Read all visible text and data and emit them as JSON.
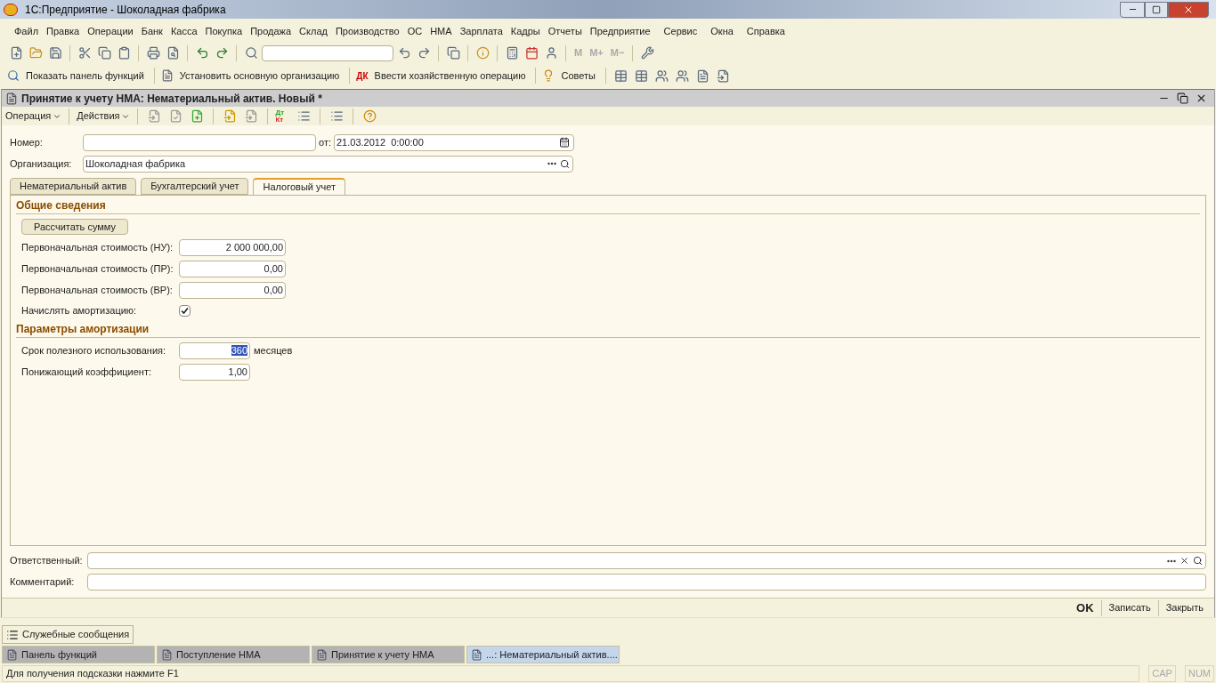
{
  "window": {
    "title": "1С:Предприятие - Шоколадная фабрика"
  },
  "menu": [
    "Файл",
    "Правка",
    "Операции",
    "Банк",
    "Касса",
    "Покупка",
    "Продажа",
    "Склад",
    "Производство",
    "ОС",
    "НМА",
    "Зарплата",
    "Кадры",
    "Отчеты",
    "Предприятие",
    "Сервис",
    "Окна",
    "Справка"
  ],
  "toolbar": {
    "memory_buttons": [
      "M",
      "M+",
      "M−"
    ]
  },
  "function_bar_icon": "ДК",
  "function_bar": [
    "Показать панель функций",
    "Установить основную организацию",
    "Ввести хозяйственную операцию",
    "Советы"
  ],
  "document": {
    "title": "Принятие к учету НМА: Нематериальный актив. Новый *",
    "toolbar": [
      "Операция",
      "Действия"
    ],
    "debit_credit_icon": [
      "Дт",
      "Кт"
    ],
    "number": {
      "label": "Номер:"
    },
    "date": {
      "label": "от:",
      "value": "21.03.2012  0:00:00"
    },
    "organization": {
      "label": "Организация:",
      "value": "Шоколадная фабрика"
    },
    "tabs": [
      {
        "label": "Нематериальный актив",
        "selected": false
      },
      {
        "label": "Бухгалтерский учет",
        "selected": false
      },
      {
        "label": "Налоговый учет",
        "selected": true
      }
    ],
    "general_section": {
      "title": "Общие сведения",
      "button": "Рассчитать сумму",
      "rows": [
        {
          "label": "Первоначальная стоимость (НУ):",
          "value": "2 000 000,00"
        },
        {
          "label": "Первоначальная стоимость (ПР):",
          "value": "0,00"
        },
        {
          "label": "Первоначальная стоимость (ВР):",
          "value": "0,00"
        }
      ],
      "depreciation": {
        "label": "Начислять амортизацию:",
        "checked": true
      }
    },
    "depreciation_section": {
      "title": "Параметры амортизации",
      "useful_life": {
        "label": "Срок полезного использования:",
        "value": "360",
        "selected": true,
        "unit": "месяцев"
      },
      "coefficient": {
        "label": "Понижающий коэффициент:",
        "value": "1,00"
      }
    },
    "responsible": {
      "label": "Ответственный:"
    },
    "comment": {
      "label": "Комментарий:"
    },
    "buttons": [
      "OK",
      "Записать",
      "Закрыть"
    ]
  },
  "messages_button": "Служебные сообщения",
  "taskbar": [
    {
      "label": "Панель функций",
      "selected": false
    },
    {
      "label": "Поступление НМА",
      "selected": false
    },
    {
      "label": "Принятие к учету НМА",
      "selected": false
    },
    {
      "label": "...: Нематериальный актив....",
      "selected": true
    }
  ],
  "status_bar": {
    "hint": "Для получения подсказки нажмите F1",
    "indicators": [
      "CAP",
      "NUM"
    ]
  }
}
